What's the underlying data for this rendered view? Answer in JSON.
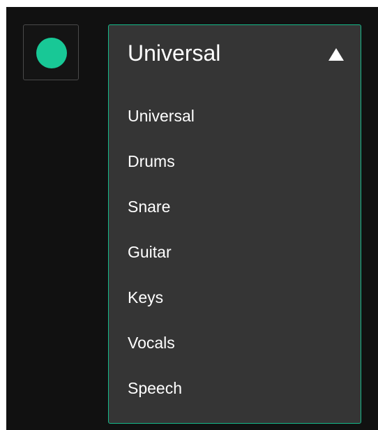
{
  "toggle": {
    "icon": "circle-indicator-icon",
    "color": "#18c896"
  },
  "dropdown": {
    "selected": "Universal",
    "expanded": true,
    "arrow_icon": "triangle-up-icon",
    "border_color": "#16b98a",
    "options": [
      {
        "label": "Universal"
      },
      {
        "label": "Drums"
      },
      {
        "label": "Snare"
      },
      {
        "label": "Guitar"
      },
      {
        "label": "Keys"
      },
      {
        "label": "Vocals"
      },
      {
        "label": "Speech"
      }
    ]
  }
}
